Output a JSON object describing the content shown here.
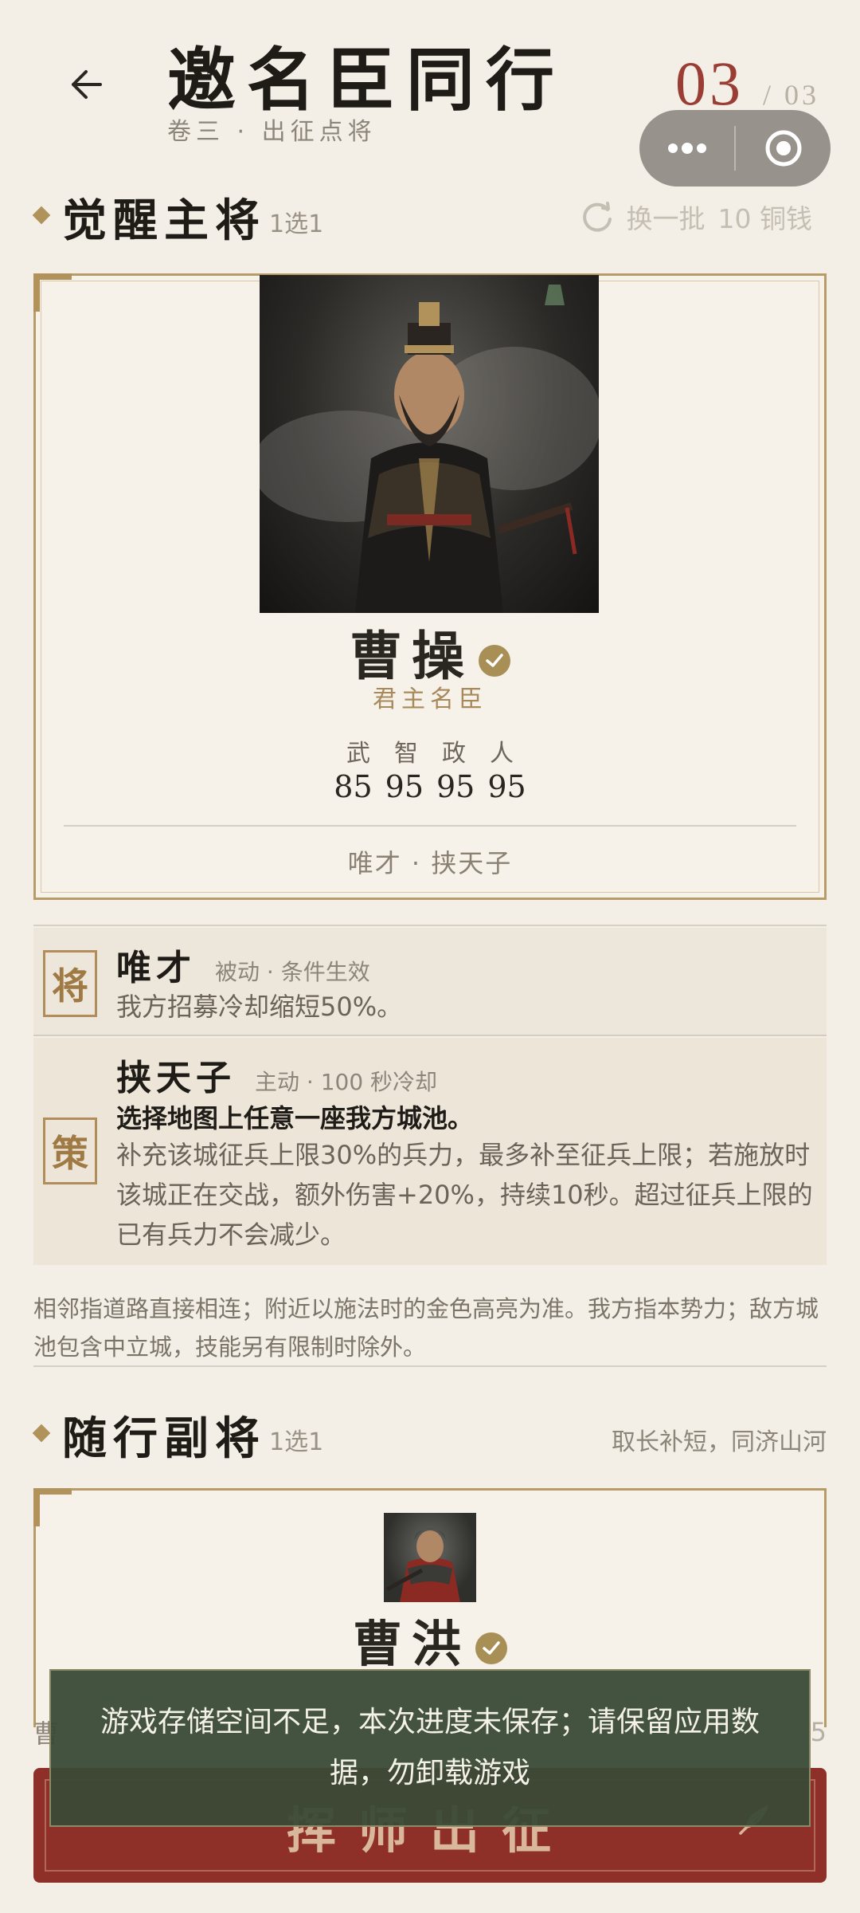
{
  "header": {
    "title": "邀名臣同行",
    "subtitle": "卷三 · 出征点将",
    "count_current": "03",
    "count_total": "/ 03"
  },
  "section_main": {
    "title": "觉醒主将",
    "pick_rule": "1选1",
    "refresh_label": "换一批",
    "refresh_cost": "10 铜钱"
  },
  "hero": {
    "name": "曹操",
    "role": "君主名臣",
    "stat_labels": [
      "武",
      "智",
      "政",
      "人"
    ],
    "stat_values": [
      "85",
      "95",
      "95",
      "95"
    ],
    "traits": "唯才 · 挟天子"
  },
  "skills": [
    {
      "seal": "将",
      "name": "唯才",
      "type": "被动 · 条件生效",
      "bold": "",
      "desc": "我方招募冷却缩短50%。"
    },
    {
      "seal": "策",
      "name": "挟天子",
      "type": "主动 · 100 秒冷却",
      "bold": "选择地图上任意一座我方城池。",
      "desc": "补充该城征兵上限30%的兵力，最多补至征兵上限；若施放时该城正在交战，额外伤害+20%，持续10秒。超过征兵上限的已有兵力不会减少。"
    }
  ],
  "note": "相邻指道路直接相连；附近以施法时的金色高亮为准。我方指本势力；敌方城池包含中立城，技能另有限制时除外。",
  "section_sub": {
    "title": "随行副将",
    "pick_rule": "1选1",
    "tagline": "取长补短，同济山河"
  },
  "sub_hero": {
    "name": "曹洪"
  },
  "peek": {
    "left": "曹",
    "right": "5"
  },
  "march_button": "挥师出征",
  "toast": "游戏存储空间不足，本次进度未保存；请保留应用数据，勿卸载游戏",
  "colors": {
    "accent_gold": "#b0925a",
    "count_red": "#9a3d34",
    "button_red": "#8f3028",
    "toast_bg": "#3a4a36"
  },
  "icons": {
    "back": "arrow-left-icon",
    "more": "more-dots-icon",
    "close": "target-circle-icon",
    "refresh": "refresh-icon",
    "check": "check-badge-icon",
    "march": "feather-icon"
  }
}
